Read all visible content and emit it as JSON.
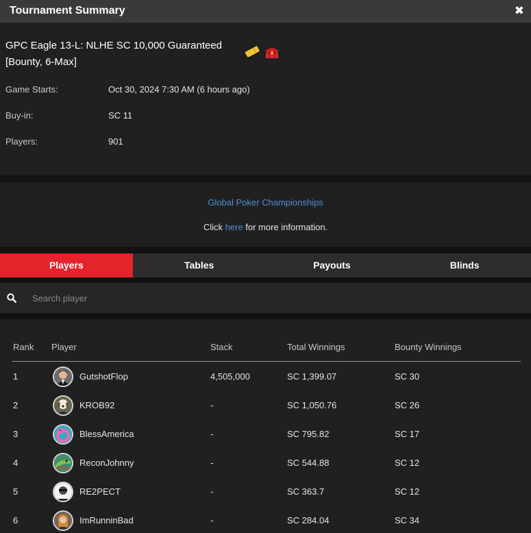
{
  "window": {
    "title": "Tournament Summary",
    "close_glyph": "✖"
  },
  "tournament": {
    "name": "GPC Eagle 13-L: NLHE SC 10,000 Guaranteed [Bounty, 6-Max]",
    "icons": [
      "ticket-icon",
      "treasure-chest-icon"
    ],
    "details": [
      {
        "label": "Game Starts:",
        "value": "Oct 30, 2024 7:30 AM (6 hours ago)"
      },
      {
        "label": "Buy-in:",
        "value": "SC 11"
      },
      {
        "label": "Players:",
        "value": "901"
      }
    ]
  },
  "promo": {
    "series": "Global Poker Championships",
    "prefix": "Click ",
    "link": "here",
    "suffix": " for more information."
  },
  "tabs": [
    {
      "label": "Players",
      "active": true
    },
    {
      "label": "Tables",
      "active": false
    },
    {
      "label": "Payouts",
      "active": false
    },
    {
      "label": "Blinds",
      "active": false
    }
  ],
  "search": {
    "placeholder": "Search player",
    "value": ""
  },
  "table": {
    "headers": {
      "rank": "Rank",
      "player": "Player",
      "stack": "Stack",
      "total": "Total Winnings",
      "bounty": "Bounty Winnings"
    },
    "rows": [
      {
        "rank": "1",
        "name": "GutshotFlop",
        "stack": "4,505,000",
        "total": "SC 1,399.07",
        "bounty": "SC 30"
      },
      {
        "rank": "2",
        "name": "KROB92",
        "stack": "-",
        "total": "SC 1,050.76",
        "bounty": "SC 26"
      },
      {
        "rank": "3",
        "name": "BlessAmerica",
        "stack": "-",
        "total": "SC 795.82",
        "bounty": "SC 17"
      },
      {
        "rank": "4",
        "name": "ReconJohnny",
        "stack": "-",
        "total": "SC 544.88",
        "bounty": "SC 12"
      },
      {
        "rank": "5",
        "name": "RE2PECT",
        "stack": "-",
        "total": "SC 363.7",
        "bounty": "SC 12"
      },
      {
        "rank": "6",
        "name": "ImRunninBad",
        "stack": "-",
        "total": "SC 284.04",
        "bounty": "SC 34"
      }
    ]
  },
  "colors": {
    "accent": "#e5232b",
    "link": "#4e8fd6",
    "panel": "#202020",
    "background": "#121212"
  }
}
